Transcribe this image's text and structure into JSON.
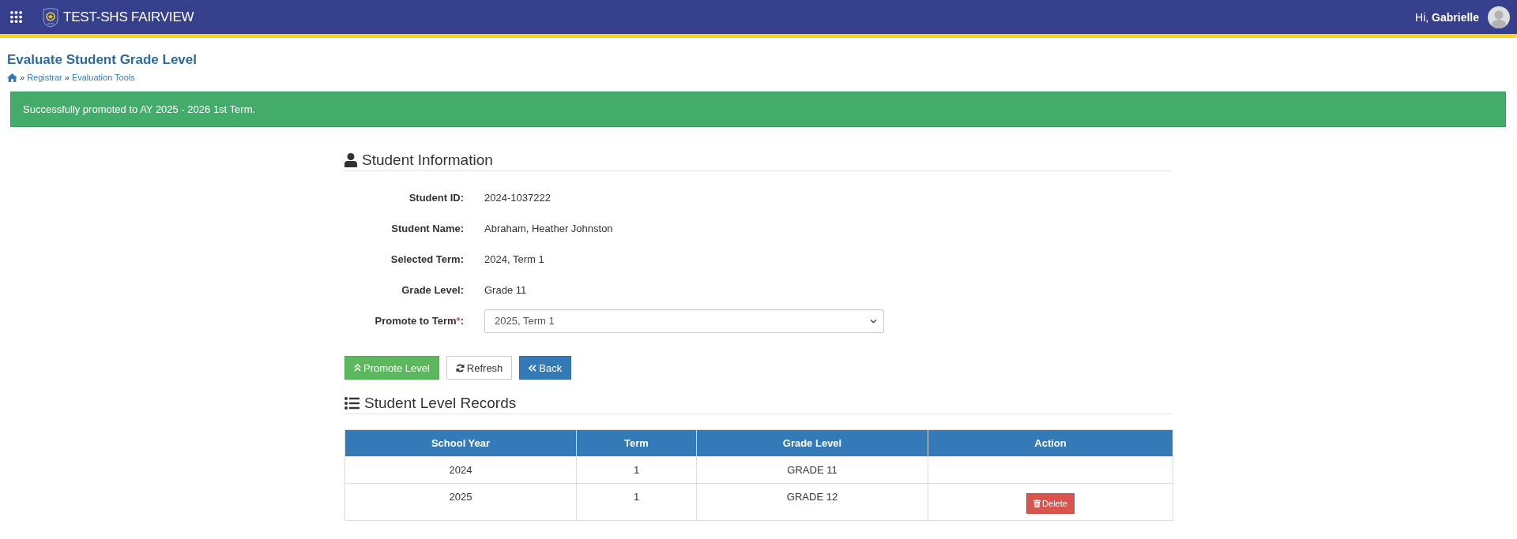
{
  "top_bar": {
    "title": "TEST-SHS FAIRVIEW",
    "greeting": "Hi, **Gabrielle**"
  },
  "page": {
    "title": "Evaluate Student Grade Level",
    "breadcrumb": [
      {
        "kind": "home"
      },
      {
        "kind": "separator",
        "text": "»"
      },
      {
        "kind": "link",
        "text": "Registrar"
      },
      {
        "kind": "separator",
        "text": "»"
      },
      {
        "kind": "link",
        "text": "Evaluation Tools"
      }
    ]
  },
  "alert": {
    "kind": "success",
    "message": "Successfully promoted to AY 2025 - 2026 1st Term."
  },
  "student_information": {
    "heading": "Student Information",
    "fields": [
      {
        "kind": "text",
        "label": "Student ID:",
        "value": "2024-1037222"
      },
      {
        "kind": "text",
        "label": "Student Name:",
        "value": "Abraham, Heather Johnston"
      },
      {
        "kind": "text",
        "label": "Selected Term:",
        "value": "2024, Term 1"
      },
      {
        "kind": "text",
        "label": "Grade Level:",
        "value": "Grade 11"
      },
      {
        "kind": "select",
        "label": "Promote to Term",
        "required_mark": "*",
        "label_suffix": ":",
        "value": "2025, Term 1"
      }
    ]
  },
  "actions": [
    {
      "kind": "promote",
      "label": "Promote Level"
    },
    {
      "kind": "refresh",
      "label": "Refresh"
    },
    {
      "kind": "back",
      "label": "Back"
    }
  ],
  "records": {
    "heading": "Student Level Records",
    "columns": [
      "School Year",
      "Term",
      "Grade Level",
      "Action"
    ],
    "rows": [
      {
        "cells": [
          "2024",
          "1",
          "GRADE 11"
        ]
      },
      {
        "cells": [
          "2025",
          "1",
          "GRADE 12"
        ],
        "action": "Delete"
      }
    ]
  }
}
